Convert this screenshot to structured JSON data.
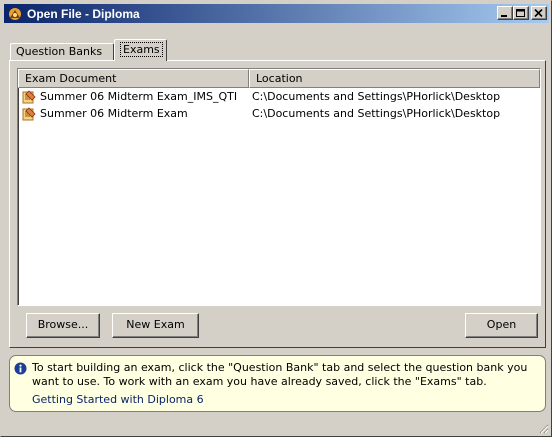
{
  "window": {
    "title": "Open File - Diploma",
    "icon": "diploma-app-icon",
    "controls": {
      "minimize": "minimize-icon",
      "maximize": "maximize-icon",
      "close": "close-icon"
    }
  },
  "tabs": [
    {
      "label": "Question Banks",
      "selected": false
    },
    {
      "label": "Exams",
      "selected": true
    }
  ],
  "list": {
    "columns": [
      "Exam Document",
      "Location"
    ],
    "rows": [
      {
        "document": "Summer 06 Midterm Exam_IMS_QTI",
        "location": "C:\\Documents and Settings\\PHorlick\\Desktop",
        "icon": "exam-document-icon"
      },
      {
        "document": "Summer 06 Midterm Exam",
        "location": "C:\\Documents and Settings\\PHorlick\\Desktop",
        "icon": "exam-document-icon"
      }
    ]
  },
  "buttons": {
    "browse": "Browse...",
    "new_exam": "New Exam",
    "open": "Open"
  },
  "info": {
    "icon": "info-icon",
    "text": "To start building an exam, click the \"Question Bank\" tab and select the question bank you want to use.  To work with an exam you have already saved, click the \"Exams\" tab.",
    "link": "Getting Started with Diploma 6"
  },
  "colors": {
    "face": "#d4d0c8",
    "title_start": "#0a246a",
    "title_end": "#a6caf0",
    "info_bg": "#ffffe1",
    "link": "#0a246a"
  }
}
